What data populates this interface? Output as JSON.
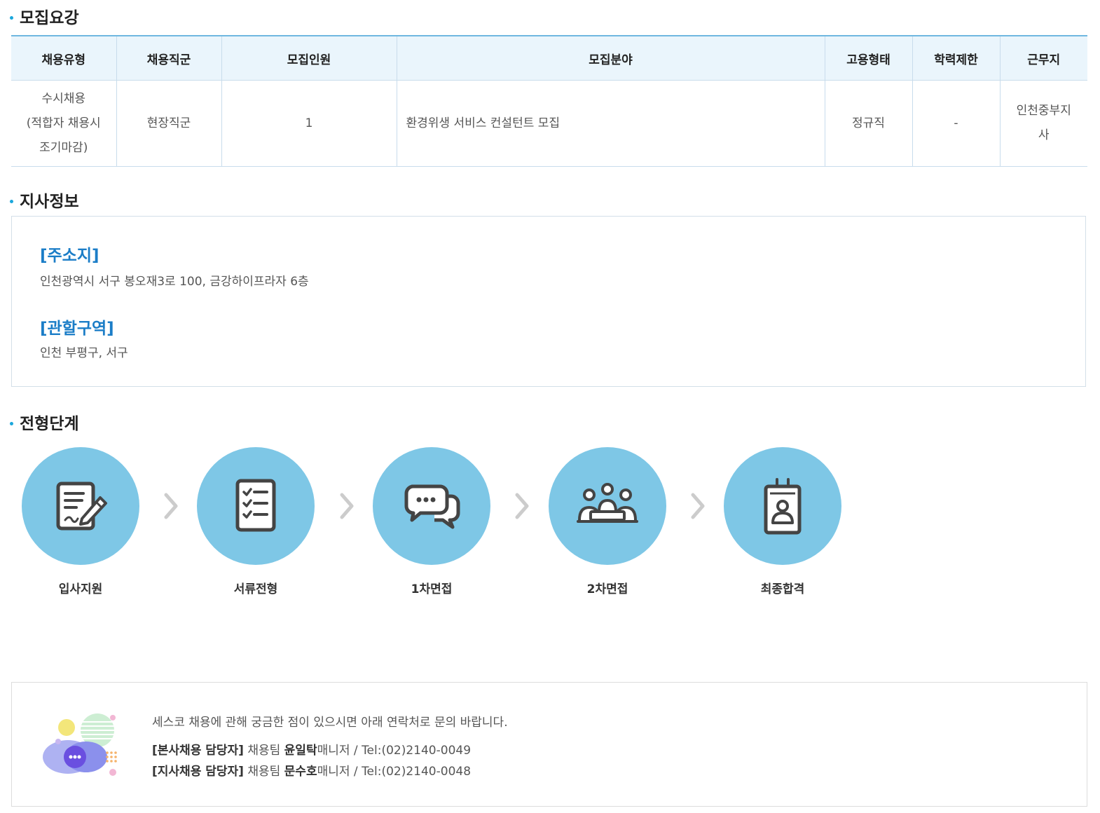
{
  "sections": {
    "recruit_title": "모집요강",
    "branch_title": "지사정보",
    "process_title": "전형단계"
  },
  "recruit_table": {
    "headers": [
      "채용유형",
      "채용직군",
      "모집인원",
      "모집분야",
      "고용형태",
      "학력제한",
      "근무지"
    ],
    "row": [
      "수시채용\n(적합자 채용시\n조기마감)",
      "현장직군",
      "1",
      "환경위생 서비스 컨설턴트 모집",
      "정규직",
      "-",
      "인천중부지\n사"
    ]
  },
  "branch": {
    "address_heading": "[주소지]",
    "address": "인천광역시 서구 봉오재3로 100, 금강하이프라자 6층",
    "area_heading": "[관할구역]",
    "area": "인천 부평구, 서구"
  },
  "steps": [
    {
      "label": "입사지원",
      "icon": "application-form-icon"
    },
    {
      "label": "서류전형",
      "icon": "checklist-icon"
    },
    {
      "label": "1차면접",
      "icon": "chat-bubbles-icon"
    },
    {
      "label": "2차면접",
      "icon": "group-interview-icon"
    },
    {
      "label": "최종합격",
      "icon": "id-badge-icon"
    }
  ],
  "contact": {
    "intro": "세스코 채용에 관해 궁금한 점이 있으시면 아래 연락처로 문의 바랍니다.",
    "hq": {
      "label": "[본사채용 담당자]",
      "team": "채용팀",
      "name": "윤일탁",
      "title": "매니저",
      "tel": "Tel:(02)2140-0049"
    },
    "branch": {
      "label": "[지사채용 담당자]",
      "team": "채용팀",
      "name": "문수호",
      "title": "매니저",
      "tel": "Tel:(02)2140-0048"
    }
  },
  "colors": {
    "accent": "#1ba7dc",
    "heading_blue": "#1b7dc7",
    "step_circle": "#7ec7e6",
    "table_header_bg": "#eaf5fc"
  }
}
